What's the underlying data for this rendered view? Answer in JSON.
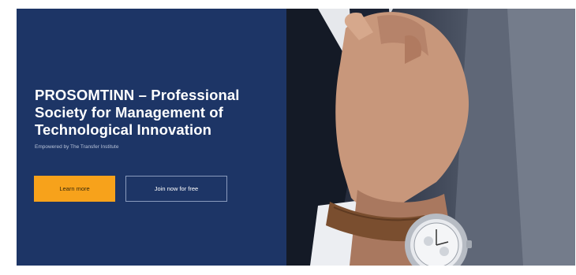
{
  "hero": {
    "title": "PROSOMTINN – Professional Society for Management of Technological Innovation",
    "subtitle": "Empowered by The Transfer Institute",
    "learn_more_label": "Learn more",
    "join_label": "Join now for free",
    "image_alt": "Man in suit adjusting tie, wearing wristwatch"
  },
  "colors": {
    "panel": "#1d3566",
    "accent": "#f7a21b",
    "text": "#ffffff"
  }
}
